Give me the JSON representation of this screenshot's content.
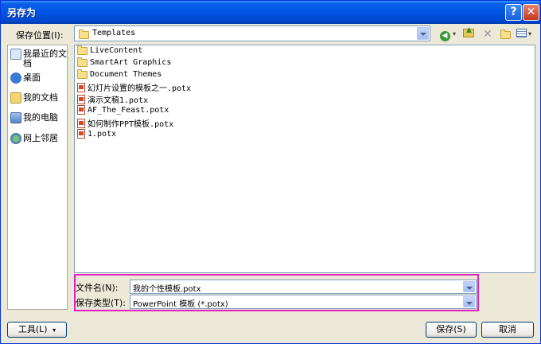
{
  "window": {
    "title": "另存为"
  },
  "location": {
    "label": "保存位置(I):",
    "value": "Templates"
  },
  "places": [
    {
      "label": "我最近的文档",
      "icon": "recent-docs-icon"
    },
    {
      "label": "桌面",
      "icon": "desktop-icon"
    },
    {
      "label": "我的文档",
      "icon": "my-documents-icon"
    },
    {
      "label": "我的电脑",
      "icon": "my-computer-icon"
    },
    {
      "label": "网上邻居",
      "icon": "network-places-icon"
    }
  ],
  "files": [
    {
      "name": "LiveContent",
      "type": "folder"
    },
    {
      "name": "SmartArt Graphics",
      "type": "folder"
    },
    {
      "name": "Document Themes",
      "type": "folder"
    },
    {
      "name": "幻灯片设置的模板之一.potx",
      "type": "potx"
    },
    {
      "name": "演示文稿1.potx",
      "type": "potx"
    },
    {
      "name": "AF_The_Feast.potx",
      "type": "potx"
    },
    {
      "name": "如何制作PPT模板.potx",
      "type": "potx"
    },
    {
      "name": "1.potx",
      "type": "potx"
    }
  ],
  "filename": {
    "label": "文件名(N):",
    "value": "我的个性模板.potx"
  },
  "filetype": {
    "label": "保存类型(T):",
    "value": "PowerPoint 模板 (*.potx)"
  },
  "buttons": {
    "tools": "工具(L)",
    "save": "保存(S)",
    "cancel": "取消"
  },
  "colors": {
    "titlebar": "#0054E3",
    "highlight": "#E020C0",
    "dialog_bg": "#ECE9D8"
  }
}
